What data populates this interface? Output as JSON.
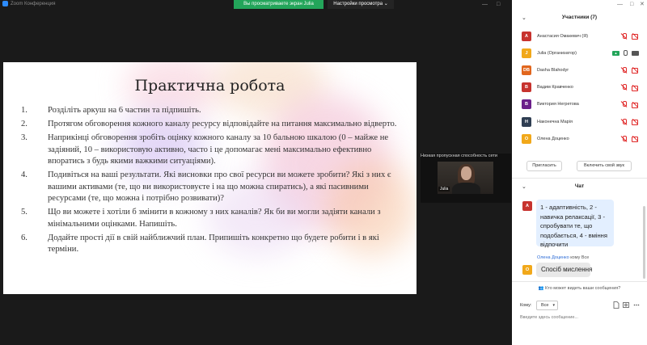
{
  "window": {
    "app_title": "Zoom Конференция",
    "share_banner": "Вы просматриваете экран Julia",
    "view_settings": "Настройки просмотра"
  },
  "slide": {
    "title": "Практична робота",
    "items": [
      {
        "num": "1.",
        "text": "Розділіть аркуш на 6 частин та підпишіть."
      },
      {
        "num": "2.",
        "text": "Протягом обговорення кожного каналу ресурсу відповідайте на питання максимально відверто."
      },
      {
        "num": "3.",
        "text": "Наприкінці обговорення зробіть оцінку кожного каналу за 10 бальною шкалою (0 – майже не задіяний, 10 – використовую активно, часто і це допомагає мені максимально ефективно впоратись з будь якими важкими ситуаціями)."
      },
      {
        "num": "4.",
        "text": "Подивіться на ваші результати. Які висновки про свої ресурси ви можете зробити? Які з них є вашими активами (те, що ви використовуєте і на що можна спиратись), а які пасивними ресурсами (те, що можна і потрібно розвивати)?"
      },
      {
        "num": "5.",
        "text": "Що ви можете і хотіли б змінити в кожному з них каналів? Як би ви могли задіяти канали з мінімальними оцінками. Напишіть."
      },
      {
        "num": "6.",
        "text": "Додайте прості дії в свій найближчий план. Припишіть конкретно що будете робити і в які терміни."
      }
    ]
  },
  "video": {
    "bandwidth_notice": "Низкая пропускная способность сети",
    "name": "Julia"
  },
  "participants": {
    "title": "Участники (7)",
    "list": [
      {
        "initials": "А",
        "color": "#c7332e",
        "name": "Анастасия Омакевич (Я)",
        "status": "muted"
      },
      {
        "initials": "J",
        "color": "#f1a81a",
        "name": "Julia (Организатор)",
        "status": "host"
      },
      {
        "initials": "DB",
        "color": "#e1661d",
        "name": "Dasha Blahodyr",
        "status": "muted"
      },
      {
        "initials": "В",
        "color": "#c7332e",
        "name": "Вадим Кравченко",
        "status": "muted"
      },
      {
        "initials": "В",
        "color": "#6b1f8a",
        "name": "Виктория Негретова",
        "status": "muted"
      },
      {
        "initials": "Н",
        "color": "#2f3e52",
        "name": "Наконечна Марія",
        "status": "muted"
      },
      {
        "initials": "О",
        "color": "#f1a81a",
        "name": "Олена Доценко",
        "status": "muted"
      }
    ],
    "invite_button": "Пригласить",
    "unmute_button": "Включить свой звук"
  },
  "chat": {
    "title": "Чат",
    "message1": {
      "initials": "А",
      "text": "1 - адаптивність, 2 - навичка релаксації, 3 - спробувати те, що подобається, 4 - вміння відпочити"
    },
    "message2": {
      "sender": "Олена Доценко",
      "to": "кому Все",
      "initials": "О",
      "text": "Спосіб мислення"
    },
    "who_sees": "Кто может видеть ваши сообщения?",
    "to_label": "Кому:",
    "to_value": "Все",
    "input_placeholder": "Введите здесь сообщение..."
  }
}
